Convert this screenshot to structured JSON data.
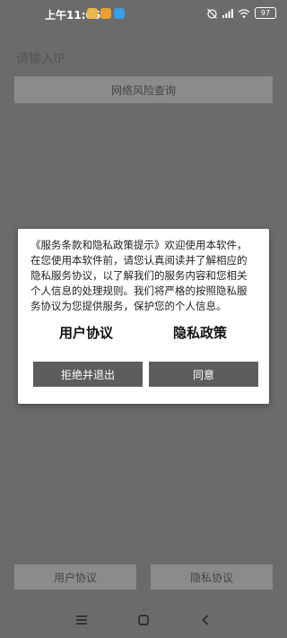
{
  "status_bar": {
    "time": "上午11:06",
    "battery": "97",
    "notification_colors": [
      "#e8b84a",
      "#e8a030",
      "#3a9ee8"
    ]
  },
  "main": {
    "ip_placeholder": "请输入IP",
    "query_button": "网络风险查询"
  },
  "dialog": {
    "text": "《服务条款和隐私政策提示》欢迎使用本软件，在您使用本软件前，请您认真阅读并了解相应的隐私服务协议，以了解我们的服务内容和您相关个人信息的处理规则。我们将严格的按照隐私服务协议为您提供服务，保护您的个人信息。",
    "user_agreement": "用户协议",
    "privacy_policy": "隐私政策",
    "reject_button": "拒绝并退出",
    "agree_button": "同意"
  },
  "bottom": {
    "user_agreement_button": "用户协议",
    "privacy_button": "隐私协议"
  },
  "nav": {
    "icons": [
      "menu-icon",
      "home-icon",
      "back-icon"
    ]
  }
}
